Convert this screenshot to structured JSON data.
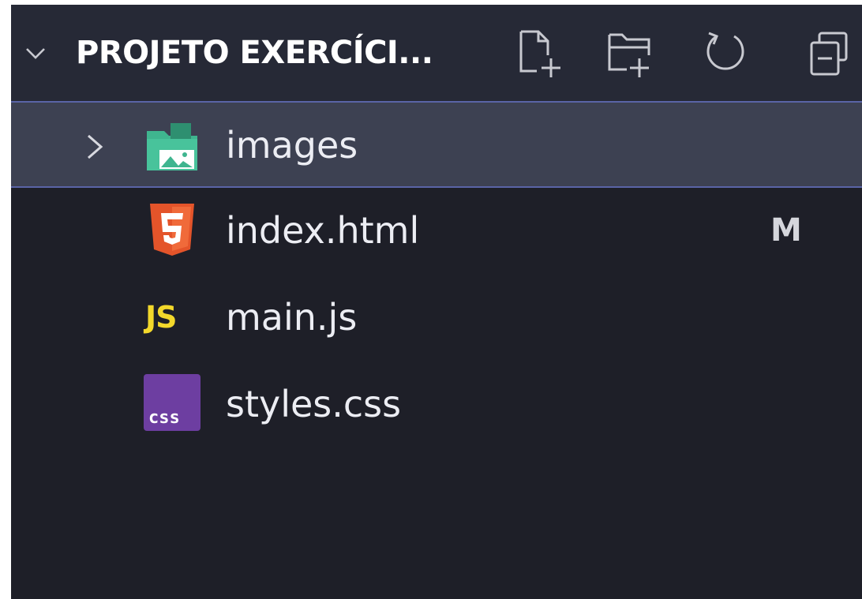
{
  "explorer": {
    "section_title": "PROJETO EXERCÍCI...",
    "actions": {
      "new_file_icon": "new-file-icon",
      "new_folder_icon": "new-folder-icon",
      "refresh_icon": "refresh-icon",
      "collapse_all_icon": "collapse-all-icon"
    },
    "items": [
      {
        "label": "images",
        "type": "folder",
        "icon": "image-folder-icon",
        "selected": true
      },
      {
        "label": "index.html",
        "type": "file",
        "icon": "html5-icon",
        "git_status": "M"
      },
      {
        "label": "main.js",
        "type": "file",
        "icon": "javascript-icon",
        "icon_text": "JS"
      },
      {
        "label": "styles.css",
        "type": "file",
        "icon": "css-icon",
        "icon_text": "css"
      }
    ]
  },
  "colors": {
    "background": "#1e1f28",
    "header_background": "#262936",
    "selected_row": "#3d4152",
    "selection_border": "#5a64a6",
    "folder_green": "#3fb58f",
    "html_orange": "#e4542a",
    "js_yellow": "#f3d82b",
    "css_purple": "#6d3ea1"
  }
}
